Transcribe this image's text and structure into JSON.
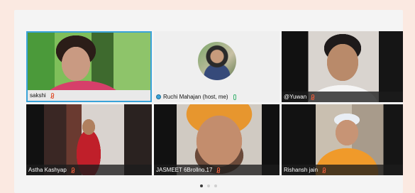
{
  "participants": [
    {
      "name": "sakshi",
      "mic": "muted",
      "active": true
    },
    {
      "name": "Ruchi  Mahajan  (host, me)",
      "mic": "on",
      "host": true
    },
    {
      "name": "@Yuwan",
      "mic": "muted"
    },
    {
      "name": "Astha Kashyap",
      "mic": "muted"
    },
    {
      "name": "JASMEET 6Brollno.17",
      "mic": "muted"
    },
    {
      "name": "Rishansh jain",
      "mic": "muted"
    }
  ],
  "pagination": {
    "pages": 3,
    "current": 1
  },
  "colors": {
    "active_border": "#3aa3d9",
    "mic_muted": "#e05a3a",
    "mic_on": "#3cb371"
  }
}
